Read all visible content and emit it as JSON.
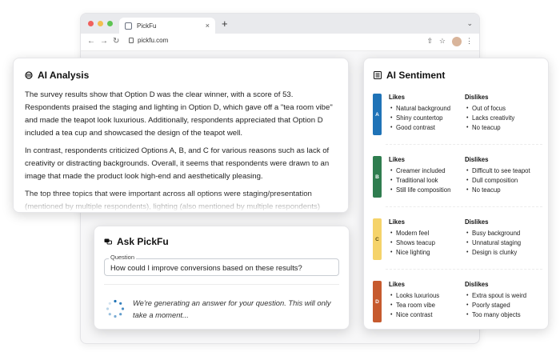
{
  "browser": {
    "tab_title": "PickFu",
    "tab_close": "×",
    "new_tab": "+",
    "chevron": "⌄",
    "url": "pickfu.com",
    "dot_colors": [
      "#f0605d",
      "#f3be4f",
      "#5ec453"
    ]
  },
  "analysis": {
    "title": "AI Analysis",
    "paragraphs": [
      "The survey results show that Option D was the clear winner, with a score of 53. Respondents praised the staging and lighting in Option D, which gave off a \"tea room vibe\" and made the teapot look luxurious. Additionally, respondents appreciated that Option D included a tea cup and showcased the design of the teapot well.",
      "In contrast, respondents criticized Options A, B, and C for various reasons such as lack of creativity or distracting backgrounds. Overall, it seems that respondents were drawn to an image that made the product look high-end and aesthetically pleasing.",
      "The top three topics that were important across all options were staging/presentation (mentioned by multiple respondents), lighting (also mentioned by multiple respondents)"
    ]
  },
  "ask": {
    "title": "Ask PickFu",
    "question_label": "Question",
    "question_value": "How could I improve conversions based on these results?",
    "generating_text": "We're generating an answer for your question. This will only take a moment..."
  },
  "sentiment": {
    "title": "AI Sentiment",
    "likes_label": "Likes",
    "dislikes_label": "Dislikes",
    "options": [
      {
        "tag": "A",
        "color": "#1f73b7",
        "likes": [
          "Natural background",
          "Shiny countertop",
          "Good contrast"
        ],
        "dislikes": [
          "Out of focus",
          "Lacks creativity",
          "No teacup"
        ]
      },
      {
        "tag": "B",
        "color": "#2f7d4f",
        "likes": [
          "Creamer included",
          "Traditional look",
          "Still life composition"
        ],
        "dislikes": [
          "Difficult to see teapot",
          "Dull composition",
          "No teacup"
        ]
      },
      {
        "tag": "C",
        "color": "#f5d36a",
        "likes": [
          "Modern feel",
          "Shows teacup",
          "Nice lighting"
        ],
        "dislikes": [
          "Busy background",
          "Unnatural staging",
          "Design is clunky"
        ]
      },
      {
        "tag": "D",
        "color": "#c65a2e",
        "likes": [
          "Looks luxurious",
          "Tea room vibe",
          "Nice contrast"
        ],
        "dislikes": [
          "Extra spout is weird",
          "Poorly staged",
          "Too many objects"
        ]
      }
    ]
  }
}
